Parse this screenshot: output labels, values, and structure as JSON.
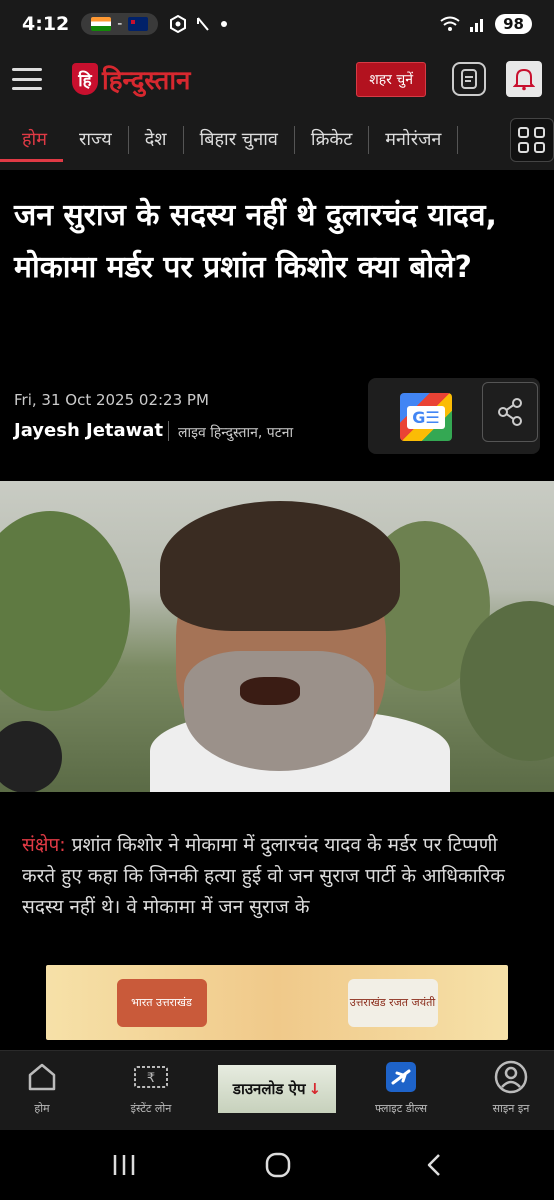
{
  "status_bar": {
    "time": "4:12",
    "pill_sep": "-",
    "battery": "98",
    "icons": [
      "india-flag-icon",
      "australia-flag-icon",
      "shield-app-icon",
      "arrow-icon",
      "dot-icon",
      "wifi-icon",
      "signal-icon"
    ]
  },
  "header": {
    "logo_mark": "हि",
    "logo_text": "हिन्दुस्तान",
    "city_button": "शहर चुनें",
    "icons": [
      "hamburger-menu-icon",
      "epaper-icon",
      "notification-bell-icon"
    ]
  },
  "nav": {
    "tabs": [
      {
        "label": "होम",
        "active": true
      },
      {
        "label": "राज्य",
        "active": false
      },
      {
        "label": "देश",
        "active": false
      },
      {
        "label": "बिहार चुनाव",
        "active": false
      },
      {
        "label": "क्रिकेट",
        "active": false
      },
      {
        "label": "मनोरंजन",
        "active": false
      }
    ]
  },
  "article": {
    "headline": "जन सुराज के सदस्य नहीं थे दुलारचंद यादव, मोकामा मर्डर पर प्रशांत किशोर क्या बोले?",
    "date": "Fri, 31 Oct 2025 02:23 PM",
    "author": "Jayesh Jetawat",
    "location": "लाइव हिन्दुस्तान, पटना",
    "google_news_label": "G☰",
    "summary_label": "संक्षेप:",
    "summary_text": " प्रशांत किशोर ने मोकामा में दुलारचंद यादव के मर्डर पर टिप्पणी करते हुए कहा कि जिनकी हत्या हुई वो जन सुराज पार्टी के आधिकारिक सदस्य नहीं थे। वे मोकामा में जन सुराज के"
  },
  "ad": {
    "left_text": "भारत उत्तराखंड",
    "right_text": "उत्तराखंड रजत जयंती"
  },
  "bottom_nav": {
    "items": [
      {
        "label": "होम",
        "icon": "home-icon"
      },
      {
        "label": "इंस्टेंट लोन",
        "icon": "rupee-note-icon"
      },
      {
        "label": "फ्लाइट डील्स",
        "icon": "airplane-icon"
      },
      {
        "label": "साइन इन",
        "icon": "user-circle-icon"
      }
    ],
    "download_label": "डाउनलोड ऐप",
    "download_arrow": "↓"
  },
  "system_nav": {
    "icons": [
      "recent-apps-icon",
      "home-circle-icon",
      "back-icon"
    ]
  },
  "colors": {
    "accent": "#d7282f",
    "background": "#000000",
    "bar": "#1a1a1a"
  }
}
